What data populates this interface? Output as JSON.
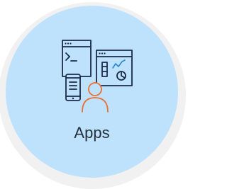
{
  "tile": {
    "label": "Apps",
    "icon": "apps-illustration-icon"
  },
  "colors": {
    "tile_background": "#bfe2fc",
    "icon_stroke": "#1b2a4a",
    "icon_accent": "#e8703a",
    "icon_highlight": "#2b86d6",
    "label_text": "#24313d"
  }
}
